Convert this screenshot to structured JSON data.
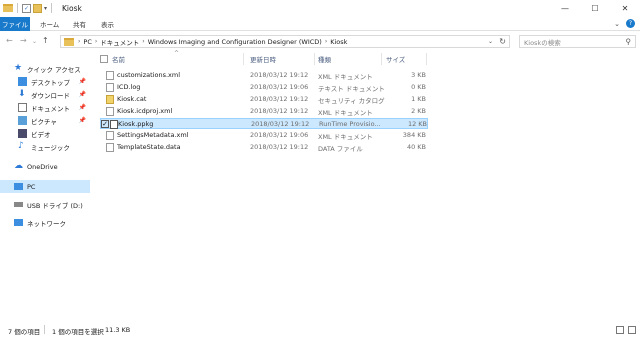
{
  "window": {
    "title": "Kiosk",
    "controls": [
      "—",
      "☐",
      "✕"
    ]
  },
  "ribbon": {
    "tabs": [
      "ファイル",
      "ホーム",
      "共有",
      "表示"
    ]
  },
  "address": {
    "crumbs": [
      "PC",
      "ドキュメント",
      "Windows Imaging and Configuration Designer (WICD)",
      "Kiosk"
    ],
    "search_placeholder": "Kioskの検索"
  },
  "sidebar": {
    "quick_access": "クイック アクセス",
    "items": [
      {
        "label": "デスクトップ",
        "icon": "desktop-icon",
        "pinned": true
      },
      {
        "label": "ダウンロード",
        "icon": "download-icon",
        "pinned": true
      },
      {
        "label": "ドキュメント",
        "icon": "document-icon",
        "pinned": true
      },
      {
        "label": "ピクチャ",
        "icon": "picture-icon",
        "pinned": true
      },
      {
        "label": "ビデオ",
        "icon": "video-icon",
        "pinned": false
      },
      {
        "label": "ミュージック",
        "icon": "music-icon",
        "pinned": false
      }
    ],
    "onedrive": "OneDrive",
    "pc": "PC",
    "usb": "USB ドライブ (D:)",
    "network": "ネットワーク"
  },
  "columns": {
    "name": "名前",
    "date": "更新日時",
    "type": "種類",
    "size": "サイズ"
  },
  "files": [
    {
      "name": "customizations.xml",
      "date": "2018/03/12 19:12",
      "type": "XML ドキュメント",
      "size": "3 KB",
      "icon": "xml-file-icon"
    },
    {
      "name": "ICD.log",
      "date": "2018/03/12 19:06",
      "type": "テキスト ドキュメント",
      "size": "0 KB",
      "icon": "text-file-icon"
    },
    {
      "name": "Kiosk.cat",
      "date": "2018/03/12 19:12",
      "type": "セキュリティ カタログ",
      "size": "1 KB",
      "icon": "catalog-file-icon"
    },
    {
      "name": "Kiosk.icdproj.xml",
      "date": "2018/03/12 19:12",
      "type": "XML ドキュメント",
      "size": "2 KB",
      "icon": "xml-file-icon"
    },
    {
      "name": "Kiosk.ppkg",
      "date": "2018/03/12 19:12",
      "type": "RunTime Provisio...",
      "size": "12 KB",
      "icon": "package-file-icon",
      "selected": true
    },
    {
      "name": "SettingsMetadata.xml",
      "date": "2018/03/12 19:06",
      "type": "XML ドキュメント",
      "size": "384 KB",
      "icon": "xml-file-icon"
    },
    {
      "name": "TemplateState.data",
      "date": "2018/03/12 19:12",
      "type": "DATA ファイル",
      "size": "40 KB",
      "icon": "data-file-icon"
    }
  ],
  "status": {
    "item_count": "7 個の項目",
    "selection": "1 個の項目を選択",
    "selection_size": "11.3 KB"
  },
  "colors": {
    "accent": "#1979ca",
    "selection": "#cce8ff",
    "selection_border": "#99d1ff"
  }
}
